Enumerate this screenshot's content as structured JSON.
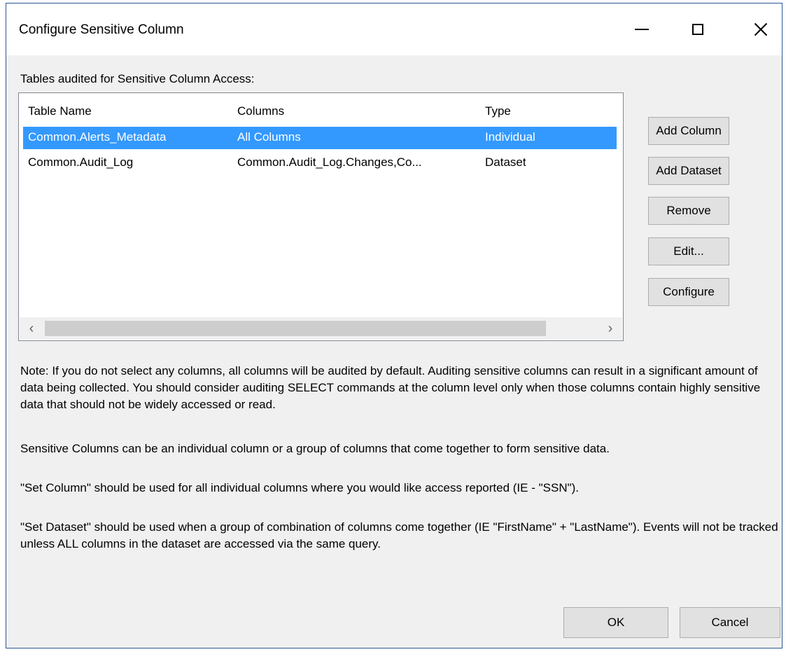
{
  "window": {
    "title": "Configure Sensitive Column"
  },
  "section_label": "Tables audited for Sensitive Column Access:",
  "table": {
    "headers": [
      "Table Name",
      "Columns",
      "Type"
    ],
    "rows": [
      [
        "Common.Alerts_Metadata",
        "All Columns",
        "Individual"
      ],
      [
        "Common.Audit_Log",
        "Common.Audit_Log.Changes,Co...",
        "Dataset"
      ]
    ],
    "selected_row": 0
  },
  "side_buttons": {
    "add_column": "Add Column",
    "add_dataset": "Add Dataset",
    "remove": "Remove",
    "edit": "Edit...",
    "configure": "Configure"
  },
  "notes": {
    "note1": "Note: If you do not select any columns, all columns will be audited by default. Auditing sensitive columns can result in a significant amount of data being collected. You should consider auditing SELECT commands at the column level only when those columns contain highly sensitive data that should not be widely accessed or read.",
    "note2": "Sensitive Columns can be an individual column or a group of columns that come together to form sensitive data.",
    "note3": "\"Set Column\" should be used for all individual columns where you would like access reported (IE - \"SSN\").",
    "note4": "\"Set Dataset\" should be used when a group of combination of columns come together (IE \"FirstName\" + \"LastName\"). Events will not be tracked unless ALL columns in the dataset are accessed via the same query."
  },
  "footer": {
    "ok": "OK",
    "cancel": "Cancel"
  },
  "colors": {
    "selection": "#3399ff",
    "dialog_background": "#f0f0f0",
    "button_face": "#e1e1e1"
  }
}
